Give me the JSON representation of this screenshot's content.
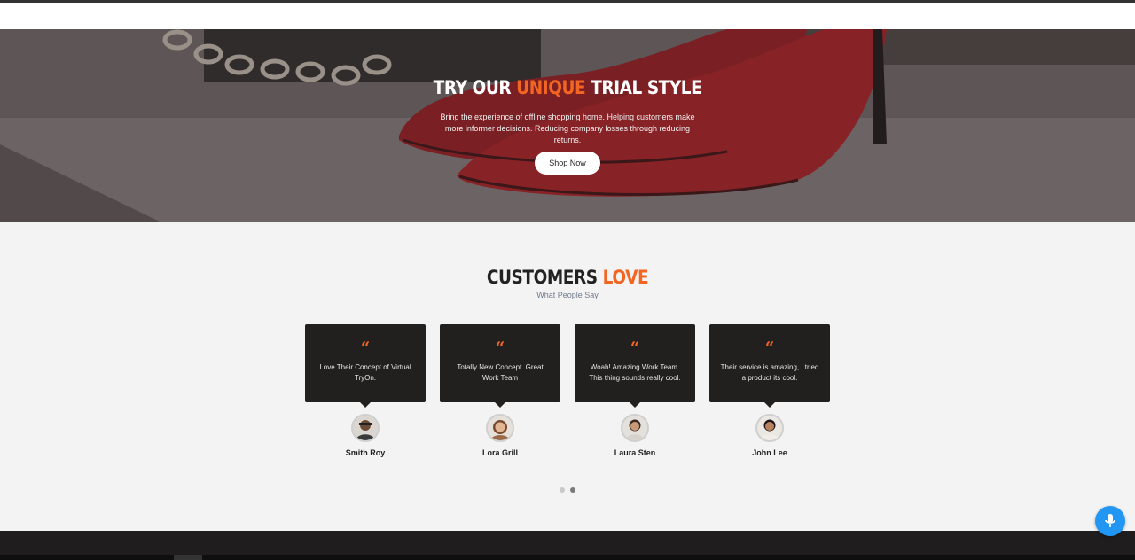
{
  "hero": {
    "title_part1": "TRY OUR ",
    "title_accent": "UNIQUE",
    "title_part2": " TRIAL STYLE",
    "description": "Bring the experience of offline shopping home. Helping customers make more informer decisions. Reducing company losses through reducing returns.",
    "button_label": "Shop Now"
  },
  "testimonials": {
    "title_part1": "CUSTOMERS ",
    "title_accent": "LOVE",
    "subtitle": "What People Say",
    "items": [
      {
        "quote_icon": "quote-icon",
        "text": "Love Their Concept of Virtual TryOn.",
        "name": "Smith Roy"
      },
      {
        "quote_icon": "quote-icon",
        "text": "Totally New Concept. Great Work Team",
        "name": "Lora Grill"
      },
      {
        "quote_icon": "quote-icon",
        "text": "Woah! Amazing Work Team. This thing sounds really cool.",
        "name": "Laura Sten"
      },
      {
        "quote_icon": "quote-icon",
        "text": "Their service is amazing, I tried a product its cool.",
        "name": "John Lee"
      }
    ],
    "carousel_dots": 2,
    "active_dot": 2
  },
  "colors": {
    "accent": "#f26522",
    "card_bg": "#221f1f",
    "mic_button": "#2196f3"
  },
  "icons": {
    "quote": "quote-icon",
    "mic": "microphone-icon"
  }
}
